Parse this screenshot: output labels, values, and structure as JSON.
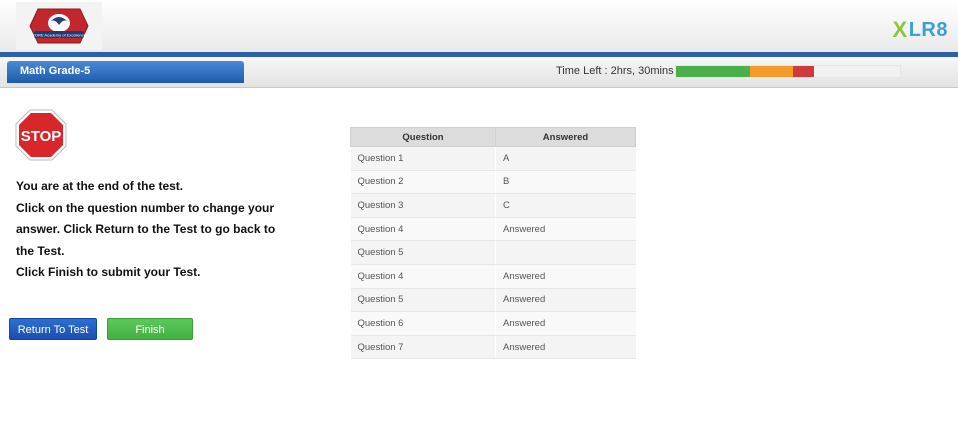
{
  "header": {
    "logo_text": "CORE Academy of Excellence",
    "brand": {
      "x": "X",
      "rest": "LR8"
    }
  },
  "test": {
    "subject": "Math Grade-5",
    "time_left": "Time Left : 2hrs, 30mins"
  },
  "message": {
    "lines": [
      "You are at the end of the test.",
      "Click on the question number to change your",
      "answer. Click Return to the Test to go back to",
      "the Test.",
      "Click Finish to submit your Test."
    ]
  },
  "stop_sign": "STOP",
  "buttons": {
    "return_label": "Return To Test",
    "finish_label": "Finish"
  },
  "table": {
    "headers": [
      "Question",
      "Answered"
    ],
    "rows": [
      [
        "Question 1",
        "A"
      ],
      [
        "Question 2",
        "B"
      ],
      [
        "Question 3",
        "C"
      ],
      [
        "Question 4",
        "Answered"
      ],
      [
        "Question 5",
        ""
      ],
      [
        "Question 4",
        "Answered"
      ],
      [
        "Question 5",
        "Answered"
      ],
      [
        "Question 6",
        "Answered"
      ],
      [
        "Question 7",
        "Answered"
      ]
    ]
  },
  "colors": {
    "green": "#4cae4c",
    "orange": "#f39c2b",
    "red": "#d03a3a",
    "blue": "#2a61aa"
  }
}
